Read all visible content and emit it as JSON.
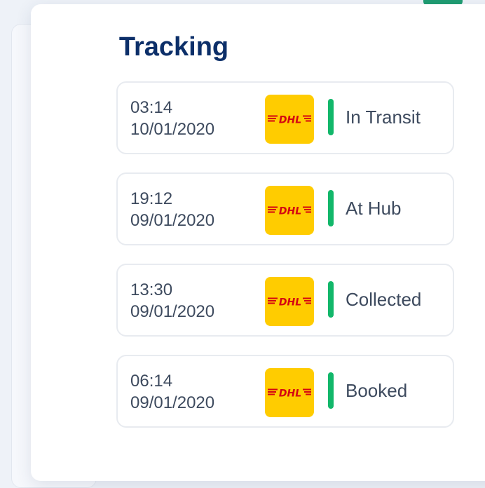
{
  "modal": {
    "title": "Tracking"
  },
  "tracking": [
    {
      "time": "03:14",
      "date": "10/01/2020",
      "carrier": "DHL",
      "carrier_icon": "dhl-logo-icon",
      "status": "In Transit"
    },
    {
      "time": "19:12",
      "date": "09/01/2020",
      "carrier": "DHL",
      "carrier_icon": "dhl-logo-icon",
      "status": "At Hub"
    },
    {
      "time": "13:30",
      "date": "09/01/2020",
      "carrier": "DHL",
      "carrier_icon": "dhl-logo-icon",
      "status": "Collected"
    },
    {
      "time": "06:14",
      "date": "09/01/2020",
      "carrier": "DHL",
      "carrier_icon": "dhl-logo-icon",
      "status": "Booked"
    }
  ],
  "colors": {
    "title": "#0c2f69",
    "status_indicator": "#12b76a",
    "dhl_yellow": "#ffcc00",
    "dhl_red": "#d40511",
    "text": "#3d4a5e"
  }
}
